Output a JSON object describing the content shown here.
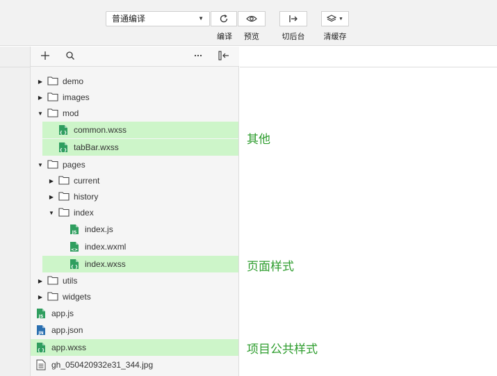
{
  "toolbar": {
    "compile_mode": "普通编译",
    "compile_label": "编译",
    "preview_label": "预览",
    "background_label": "切后台",
    "clear_cache_label": "清缓存"
  },
  "explorer": {
    "add_icon": "plus-icon",
    "search_icon": "search-icon",
    "more_icon": "ellipsis-icon",
    "collapse_icon": "collapse-panel-icon",
    "tree": [
      {
        "label": "demo",
        "type": "folder",
        "expanded": false
      },
      {
        "label": "images",
        "type": "folder",
        "expanded": false
      },
      {
        "label": "mod",
        "type": "folder",
        "expanded": true
      },
      {
        "label": "common.wxss",
        "type": "wxss",
        "highlighted": true
      },
      {
        "label": "tabBar.wxss",
        "type": "wxss",
        "highlighted": true
      },
      {
        "label": "pages",
        "type": "folder",
        "expanded": true
      },
      {
        "label": "current",
        "type": "folder",
        "expanded": false
      },
      {
        "label": "history",
        "type": "folder",
        "expanded": false
      },
      {
        "label": "index",
        "type": "folder",
        "expanded": true
      },
      {
        "label": "index.js",
        "type": "js"
      },
      {
        "label": "index.wxml",
        "type": "wxml"
      },
      {
        "label": "index.wxss",
        "type": "wxss",
        "highlighted": true
      },
      {
        "label": "utils",
        "type": "folder",
        "expanded": false
      },
      {
        "label": "widgets",
        "type": "folder",
        "expanded": false
      },
      {
        "label": "app.js",
        "type": "js"
      },
      {
        "label": "app.json",
        "type": "json"
      },
      {
        "label": "app.wxss",
        "type": "wxss",
        "highlighted": true
      },
      {
        "label": "gh_050420932e31_344.jpg",
        "type": "image"
      }
    ]
  },
  "annotations": {
    "other": "其他",
    "page_style": "页面样式",
    "project_style": "项目公共样式"
  },
  "colors": {
    "highlight": "#cdf5c9",
    "annotation": "#2e9d2e",
    "file_icon_green": "#2f9e5f",
    "json_icon_blue": "#2a6fb0"
  }
}
